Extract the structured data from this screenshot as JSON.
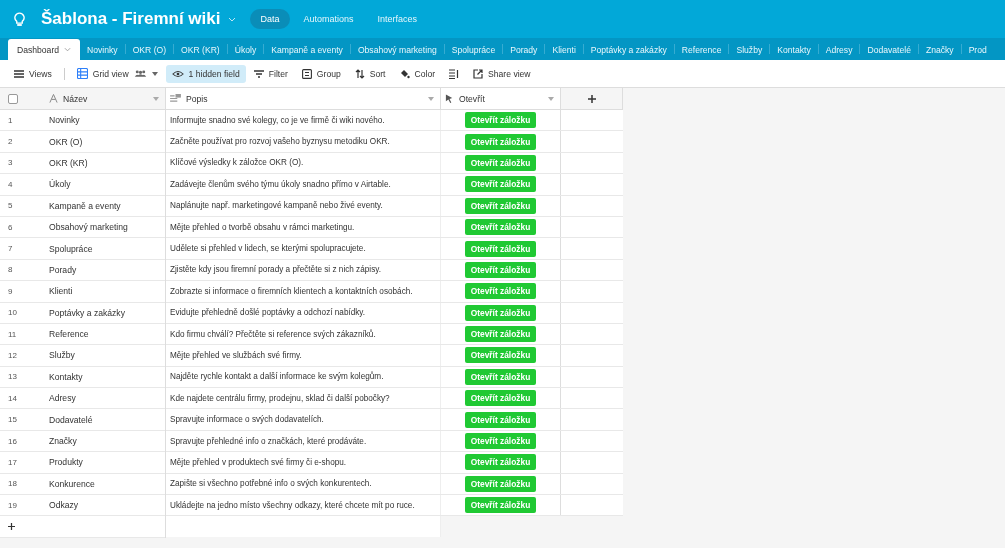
{
  "base": {
    "title": "Šablona - Firemní wiki"
  },
  "nav": [
    {
      "label": "Data",
      "selected": true
    },
    {
      "label": "Automations",
      "selected": false
    },
    {
      "label": "Interfaces",
      "selected": false
    }
  ],
  "tables": [
    {
      "label": "Dashboard",
      "selected": true
    },
    {
      "label": "Novinky",
      "selected": false
    },
    {
      "label": "OKR (O)",
      "selected": false
    },
    {
      "label": "OKR (KR)",
      "selected": false
    },
    {
      "label": "Úkoly",
      "selected": false
    },
    {
      "label": "Kampaně a eventy",
      "selected": false
    },
    {
      "label": "Obsahový marketing",
      "selected": false
    },
    {
      "label": "Spolupráce",
      "selected": false
    },
    {
      "label": "Porady",
      "selected": false
    },
    {
      "label": "Klienti",
      "selected": false
    },
    {
      "label": "Poptávky a zakázky",
      "selected": false
    },
    {
      "label": "Reference",
      "selected": false
    },
    {
      "label": "Služby",
      "selected": false
    },
    {
      "label": "Kontakty",
      "selected": false
    },
    {
      "label": "Adresy",
      "selected": false
    },
    {
      "label": "Dodavatelé",
      "selected": false
    },
    {
      "label": "Značky",
      "selected": false
    },
    {
      "label": "Prod",
      "selected": false
    }
  ],
  "toolbar": [
    {
      "kind": "views",
      "label": "Views"
    },
    {
      "kind": "grid",
      "label": "Grid view"
    },
    {
      "kind": "hidden",
      "label": "1 hidden field"
    },
    {
      "kind": "filter",
      "label": "Filter"
    },
    {
      "kind": "group",
      "label": "Group"
    },
    {
      "kind": "sort",
      "label": "Sort"
    },
    {
      "kind": "color",
      "label": "Color"
    },
    {
      "kind": "height"
    },
    {
      "kind": "share",
      "label": "Share view"
    }
  ],
  "all_selected": false,
  "columns": [
    {
      "label": "Název",
      "kind": "text"
    },
    {
      "label": "Popis",
      "kind": "longtext"
    },
    {
      "label": "Otevřít",
      "kind": "button"
    }
  ],
  "rows": [
    {
      "number": "1",
      "name": "Novinky",
      "description": "Informujte snadno své kolegy, co je ve firmě či wiki nového.",
      "action": "Otevřít záložku"
    },
    {
      "number": "2",
      "name": "OKR (O)",
      "description": "Začněte používat pro rozvoj vašeho byznysu metodiku OKR.",
      "action": "Otevřít záložku"
    },
    {
      "number": "3",
      "name": "OKR (KR)",
      "description": "Klíčové výsledky k záložce OKR (O).",
      "action": "Otevřít záložku"
    },
    {
      "number": "4",
      "name": "Úkoly",
      "description": "Zadávejte členům svého týmu úkoly snadno přímo v Airtable.",
      "action": "Otevřít záložku"
    },
    {
      "number": "5",
      "name": "Kampaně a eventy",
      "description": "Naplánujte např. marketingové kampaně nebo živé eventy.",
      "action": "Otevřít záložku"
    },
    {
      "number": "6",
      "name": "Obsahový marketing",
      "description": "Mějte přehled o tvorbě obsahu v rámci marketingu.",
      "action": "Otevřít záložku"
    },
    {
      "number": "7",
      "name": "Spolupráce",
      "description": "Udělete si přehled v lidech, se kterými spolupracujete.",
      "action": "Otevřít záložku"
    },
    {
      "number": "8",
      "name": "Porady",
      "description": "Zjistěte kdy jsou firemní porady a přečtěte si z nich zápisy.",
      "action": "Otevřít záložku"
    },
    {
      "number": "9",
      "name": "Klienti",
      "description": "Zobrazte si informace o firemních klientech a kontaktních osobách.",
      "action": "Otevřít záložku"
    },
    {
      "number": "10",
      "name": "Poptávky a zakázky",
      "description": "Evidujte přehledně došlé poptávky a odchozí nabídky.",
      "action": "Otevřít záložku"
    },
    {
      "number": "11",
      "name": "Reference",
      "description": "Kdo firmu chválí? Přečtěte si reference svých zákazníků.",
      "action": "Otevřít záložku"
    },
    {
      "number": "12",
      "name": "Služby",
      "description": "Mějte přehled ve službách své firmy.",
      "action": "Otevřít záložku"
    },
    {
      "number": "13",
      "name": "Kontakty",
      "description": "Najděte rychle kontakt a další informace ke svým kolegům.",
      "action": "Otevřít záložku"
    },
    {
      "number": "14",
      "name": "Adresy",
      "description": "Kde najdete centrálu firmy, prodejnu, sklad či další pobočky?",
      "action": "Otevřít záložku"
    },
    {
      "number": "15",
      "name": "Dodavatelé",
      "description": "Spravujte informace o svých dodavatelích.",
      "action": "Otevřít záložku"
    },
    {
      "number": "16",
      "name": "Značky",
      "description": "Spravujte přehledné info o značkách, které prodáváte.",
      "action": "Otevřít záložku"
    },
    {
      "number": "17",
      "name": "Produkty",
      "description": "Mějte přehled v produktech své firmy či e-shopu.",
      "action": "Otevřít záložku"
    },
    {
      "number": "18",
      "name": "Konkurence",
      "description": "Zapište si všechno potřebné info o svých konkurentech.",
      "action": "Otevřít záložku"
    },
    {
      "number": "19",
      "name": "Odkazy",
      "description": "Ukládejte na jedno místo všechny odkazy, které chcete mít po ruce.",
      "action": "Otevřít záložku"
    }
  ]
}
